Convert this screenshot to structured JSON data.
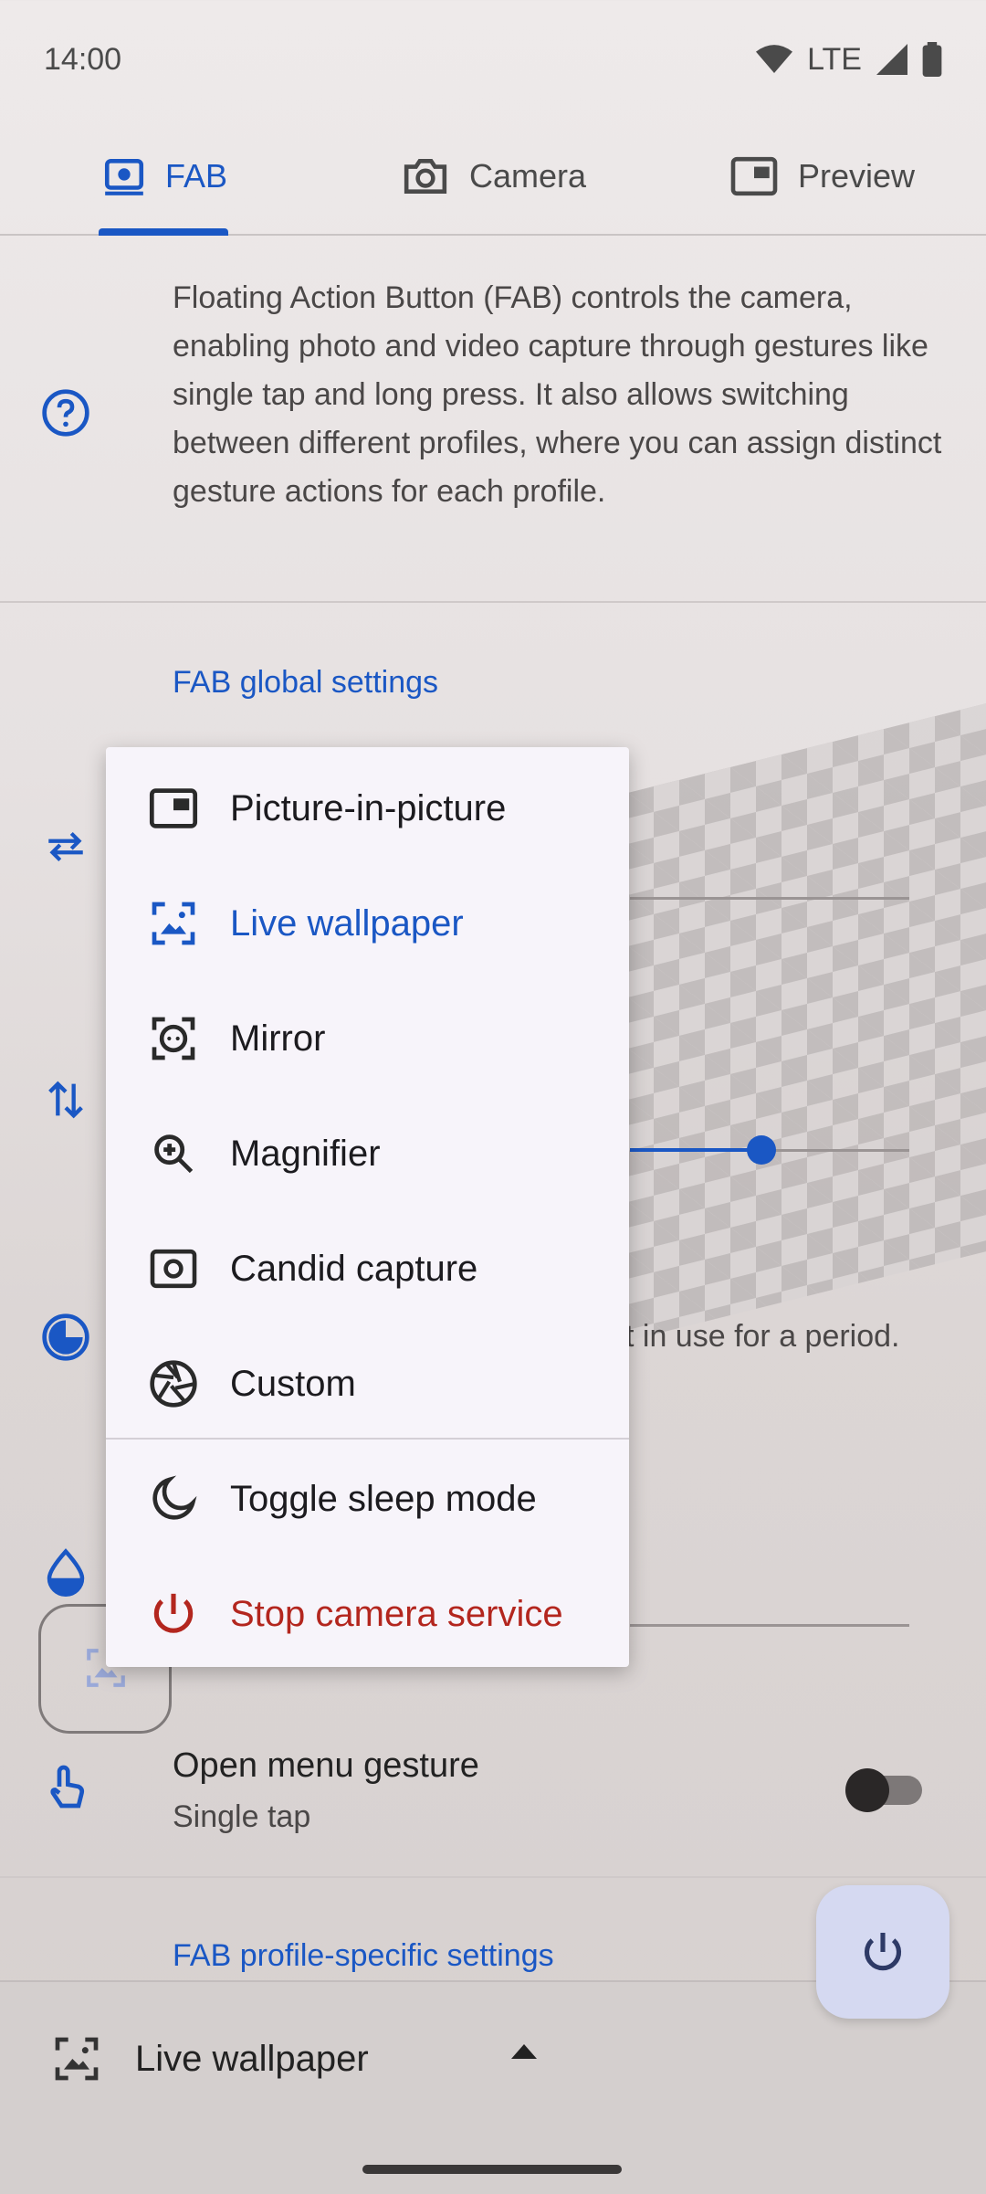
{
  "status_bar": {
    "time": "14:00",
    "network": "LTE"
  },
  "tabs": [
    {
      "label": "FAB",
      "icon": "camera-badge-icon",
      "active": true
    },
    {
      "label": "Camera",
      "icon": "camera-icon",
      "active": false
    },
    {
      "label": "Preview",
      "icon": "picture-in-picture-icon",
      "active": false
    }
  ],
  "description": "Floating Action Button (FAB) controls the camera, enabling photo and video capture through gestures like single tap and long press. It also allows switching between different profiles, where you can assign distinct gesture actions for each profile.",
  "sections": {
    "global_title": "FAB global settings",
    "profile_title": "FAB profile-specific settings"
  },
  "partial_text": "t in use for a period.",
  "gesture": {
    "title": "Open menu gesture",
    "subtitle": "Single tap",
    "enabled": false
  },
  "bottom_bar": {
    "profile_label": "Live wallpaper"
  },
  "menu": {
    "items": [
      {
        "label": "Picture-in-picture",
        "icon": "picture-in-picture-icon"
      },
      {
        "label": "Live wallpaper",
        "icon": "wallpaper-icon",
        "selected": true
      },
      {
        "label": "Mirror",
        "icon": "face-frame-icon"
      },
      {
        "label": "Magnifier",
        "icon": "zoom-in-icon"
      },
      {
        "label": "Candid capture",
        "icon": "camera-frame-icon"
      },
      {
        "label": "Custom",
        "icon": "aperture-icon"
      },
      {
        "label": "Toggle sleep mode",
        "icon": "moon-icon"
      },
      {
        "label": "Stop camera service",
        "icon": "power-icon",
        "danger": true
      }
    ]
  },
  "colors": {
    "accent": "#1a57c4",
    "danger": "#b3261e",
    "menu_bg": "#f7f4fa"
  },
  "slider_value_fraction": 0.45
}
